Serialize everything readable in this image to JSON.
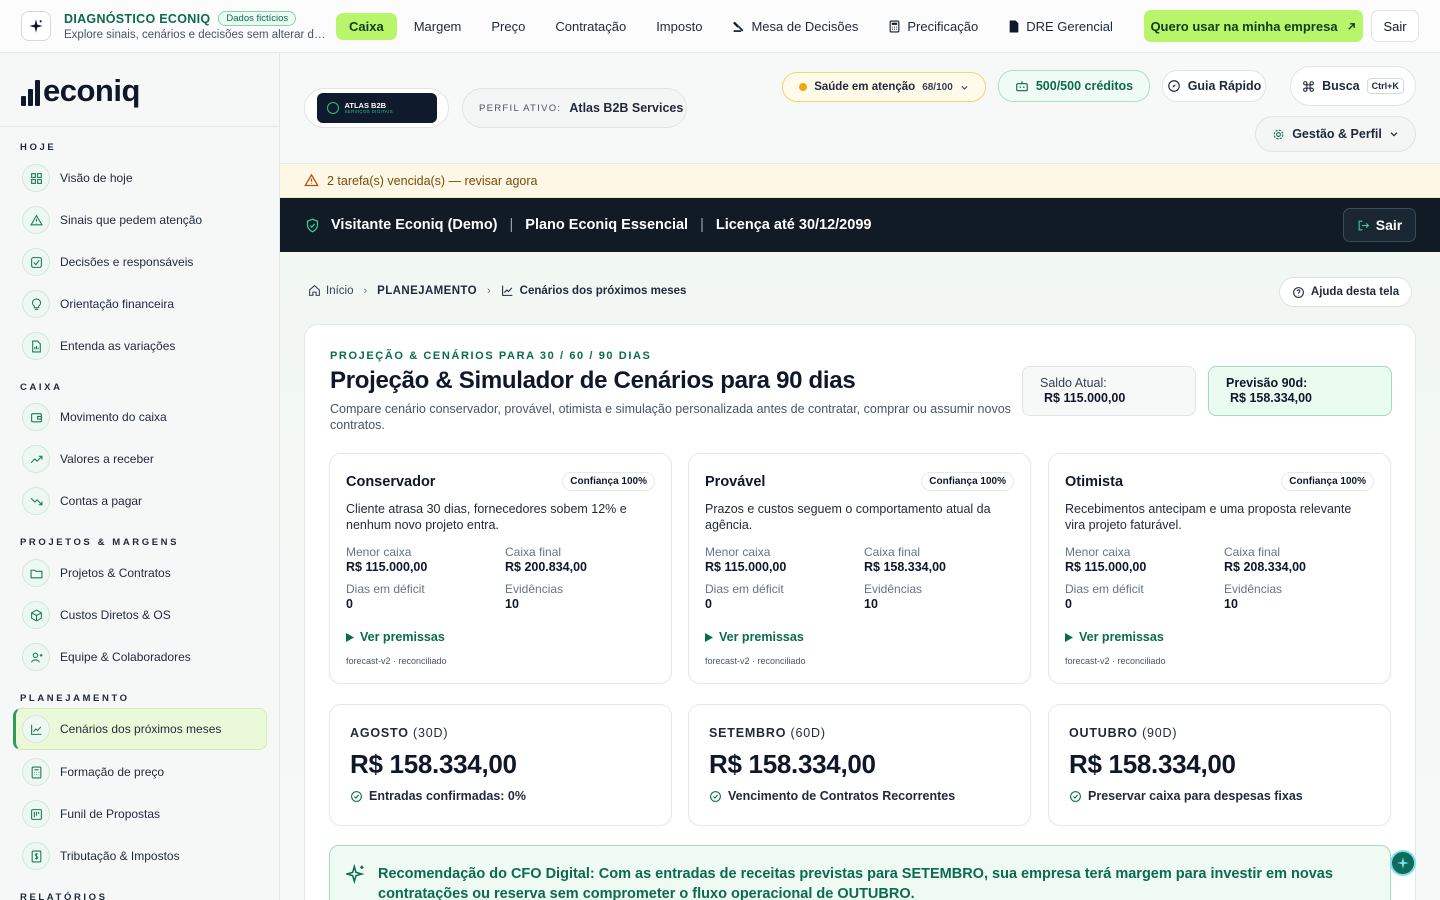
{
  "topbar": {
    "brand_title": "DIAGNÓSTICO ECONIQ",
    "brand_chip": "Dados fictícios",
    "brand_sub": "Explore sinais, cenários e decisões sem alterar dados reais",
    "nav": [
      {
        "label": "Caixa",
        "active": true,
        "icon": ""
      },
      {
        "label": "Margem",
        "icon": ""
      },
      {
        "label": "Preço",
        "icon": ""
      },
      {
        "label": "Contratação",
        "icon": ""
      },
      {
        "label": "Imposto",
        "icon": ""
      },
      {
        "label": "Mesa de Decisões",
        "icon": "gavel-icon"
      },
      {
        "label": "Precificação",
        "icon": "calculator-icon"
      },
      {
        "label": "DRE Gerencial",
        "icon": "document-icon"
      }
    ],
    "cta_label": "Quero usar na minha empresa",
    "logout_label": "Sair"
  },
  "sidebar": {
    "logo_text": "econiq",
    "sections": [
      {
        "title": "HOJE",
        "items": [
          {
            "label": "Visão de hoje",
            "icon": "grid-icon"
          },
          {
            "label": "Sinais que pedem atenção",
            "icon": "warning-icon"
          },
          {
            "label": "Decisões e responsáveis",
            "icon": "checkbox-icon"
          },
          {
            "label": "Orientação financeira",
            "icon": "lightbulb-icon"
          },
          {
            "label": "Entenda as variações",
            "icon": "file-chart-icon"
          }
        ]
      },
      {
        "title": "CAIXA",
        "items": [
          {
            "label": "Movimento do caixa",
            "icon": "wallet-icon"
          },
          {
            "label": "Valores a receber",
            "icon": "trend-up-icon"
          },
          {
            "label": "Contas a pagar",
            "icon": "trend-down-icon"
          }
        ]
      },
      {
        "title": "PROJETOS & MARGENS",
        "items": [
          {
            "label": "Projetos & Contratos",
            "icon": "folder-icon"
          },
          {
            "label": "Custos Diretos & OS",
            "icon": "box-icon"
          },
          {
            "label": "Equipe & Colaboradores",
            "icon": "user-icon"
          }
        ]
      },
      {
        "title": "PLANEJAMENTO",
        "items": [
          {
            "label": "Cenários dos próximos meses",
            "icon": "line-chart-icon",
            "active": true
          },
          {
            "label": "Formação de preço",
            "icon": "calculator-icon"
          },
          {
            "label": "Funil de Propostas",
            "icon": "funnel-icon"
          },
          {
            "label": "Tributação & Impostos",
            "icon": "tax-icon"
          }
        ]
      },
      {
        "title": "RELATÓRIOS",
        "items": []
      }
    ]
  },
  "header": {
    "client_logo_line1": "ATLAS B2B",
    "client_logo_line2": "SERVIÇOS DIGITAIS",
    "profile_label": "PERFIL ATIVO:",
    "profile_value": "Atlas B2B Services",
    "health_label": "Saúde em atenção",
    "health_score": "68/100",
    "credits_label": "500/500 créditos",
    "guide_label": "Guia Rápido",
    "search_label": "Busca",
    "search_shortcut": "Ctrl+K",
    "settings_label": "Gestão & Perfil"
  },
  "alert": {
    "text": "2 tarefa(s) vencida(s) — revisar agora"
  },
  "account_bar": {
    "user": "Visitante Econiq (Demo)",
    "plan": "Plano Econiq Essencial",
    "license": "Licença até 30/12/2099",
    "logout_label": "Sair"
  },
  "breadcrumb": {
    "home": "Início",
    "section": "PLANEJAMENTO",
    "page": "Cenários dos próximos meses",
    "help_label": "Ajuda desta tela"
  },
  "page": {
    "kicker": "PROJEÇÃO & CENÁRIOS PARA 30 / 60 / 90 DIAS",
    "title": "Projeção & Simulador de Cenários para 90 dias",
    "description": "Compare cenário conservador, provável, otimista e simulação personalizada antes de contratar, comprar ou assumir novos contratos.",
    "current_balance_label": "Saldo Atual:",
    "current_balance_value": "R$ 115.000,00",
    "forecast_label": "Previsão 90d:",
    "forecast_value": "R$ 158.334,00"
  },
  "scenarios": [
    {
      "name": "Conservador",
      "confidence": "Confiança 100%",
      "description": "Cliente atrasa 30 dias, fornecedores sobem 12% e nenhum novo projeto entra.",
      "min_cash_label": "Menor caixa",
      "min_cash": "R$ 115.000,00",
      "final_cash_label": "Caixa final",
      "final_cash": "R$ 200.834,00",
      "deficit_label": "Dias em déficit",
      "deficit": "0",
      "evidence_label": "Evidências",
      "evidence": "10",
      "premises_label": "Ver premissas",
      "footer": "forecast-v2 · reconciliado"
    },
    {
      "name": "Provável",
      "confidence": "Confiança 100%",
      "description": "Prazos e custos seguem o comportamento atual da agência.",
      "min_cash_label": "Menor caixa",
      "min_cash": "R$ 115.000,00",
      "final_cash_label": "Caixa final",
      "final_cash": "R$ 158.334,00",
      "deficit_label": "Dias em déficit",
      "deficit": "0",
      "evidence_label": "Evidências",
      "evidence": "10",
      "premises_label": "Ver premissas",
      "footer": "forecast-v2 · reconciliado"
    },
    {
      "name": "Otimista",
      "confidence": "Confiança 100%",
      "description": "Recebimentos antecipam e uma proposta relevante vira projeto faturável.",
      "min_cash_label": "Menor caixa",
      "min_cash": "R$ 115.000,00",
      "final_cash_label": "Caixa final",
      "final_cash": "R$ 208.334,00",
      "deficit_label": "Dias em déficit",
      "deficit": "0",
      "evidence_label": "Evidências",
      "evidence": "10",
      "premises_label": "Ver premissas",
      "footer": "forecast-v2 · reconciliado"
    }
  ],
  "months": [
    {
      "month": "AGOSTO",
      "period": "(30D)",
      "value": "R$ 158.334,00",
      "note": "Entradas confirmadas: 0%"
    },
    {
      "month": "SETEMBRO",
      "period": "(60D)",
      "value": "R$ 158.334,00",
      "note": "Vencimento de Contratos Recorrentes"
    },
    {
      "month": "OUTUBRO",
      "period": "(90D)",
      "value": "R$ 158.334,00",
      "note": "Preservar caixa para despesas fixas"
    }
  ],
  "recommendation": {
    "text": "Recomendação do CFO Digital: Com as entradas de receitas previstas para SETEMBRO, sua empresa terá margem para investir em novas contratações ou reserva sem comprometer o fluxo operacional de OUTUBRO."
  },
  "colors": {
    "accent": "#b9f56b",
    "brand_green": "#0b6b4f",
    "dark_bar": "#111b25",
    "warning": "#f3a712"
  }
}
